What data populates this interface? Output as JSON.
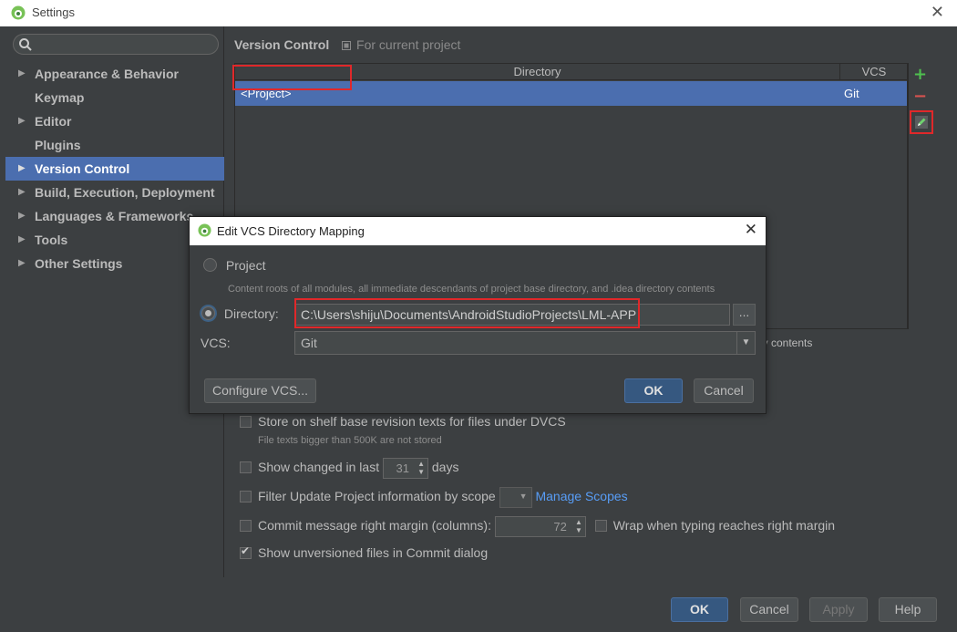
{
  "window": {
    "title": "Settings"
  },
  "sidebar": {
    "search_placeholder": "",
    "items": [
      {
        "label": "Appearance & Behavior",
        "expandable": true,
        "selected": false
      },
      {
        "label": "Keymap",
        "expandable": false,
        "selected": false
      },
      {
        "label": "Editor",
        "expandable": true,
        "selected": false
      },
      {
        "label": "Plugins",
        "expandable": false,
        "selected": false
      },
      {
        "label": "Version Control",
        "expandable": true,
        "selected": true
      },
      {
        "label": "Build, Execution, Deployment",
        "expandable": true,
        "selected": false
      },
      {
        "label": "Languages & Frameworks",
        "expandable": true,
        "selected": false
      },
      {
        "label": "Tools",
        "expandable": true,
        "selected": false
      },
      {
        "label": "Other Settings",
        "expandable": true,
        "selected": false
      }
    ]
  },
  "main": {
    "title": "Version Control",
    "scope": "For current project",
    "table": {
      "columns": [
        "Directory",
        "VCS"
      ],
      "rows": [
        {
          "directory": "<Project>",
          "vcs": "Git"
        }
      ]
    },
    "tools": {
      "add": "+",
      "remove": "−"
    },
    "background_note": "ory contents",
    "options": {
      "store_shelf": "Store on shelf base revision texts for files under DVCS",
      "store_shelf_hint": "File texts bigger than 500K are not stored",
      "show_changed_prefix": "Show changed in last",
      "show_changed_value": "31",
      "show_changed_suffix": "days",
      "filter_update": "Filter Update Project information by scope",
      "manage_scopes": "Manage Scopes",
      "commit_margin": "Commit message right margin (columns):",
      "commit_margin_value": "72",
      "wrap_typing": "Wrap when typing reaches right margin",
      "show_unversioned": "Show unversioned files in Commit dialog"
    }
  },
  "footer": {
    "ok": "OK",
    "cancel": "Cancel",
    "apply": "Apply",
    "help": "Help"
  },
  "dialog": {
    "title": "Edit VCS Directory Mapping",
    "project_label": "Project",
    "project_desc": "Content roots of all modules, all immediate descendants of project base directory, and .idea directory contents",
    "directory_label": "Directory:",
    "directory_value": "C:\\Users\\shiju\\Documents\\AndroidStudioProjects\\LML-APP",
    "browse": "...",
    "vcs_label": "VCS:",
    "vcs_value": "Git",
    "configure": "Configure VCS...",
    "ok": "OK",
    "cancel": "Cancel"
  },
  "colors": {
    "accent": "#4b6eaf",
    "highlight_box": "#e0282a",
    "link": "#589df6",
    "add": "#4fc04f",
    "remove": "#d9534f"
  }
}
